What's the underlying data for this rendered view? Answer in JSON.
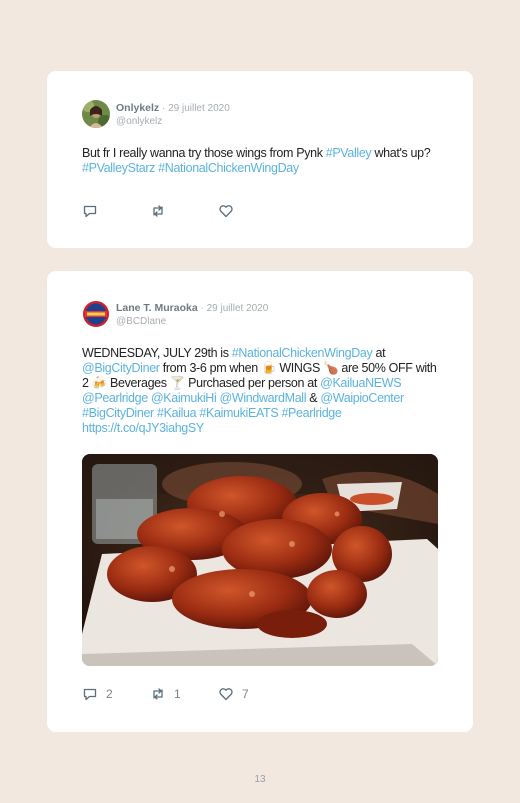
{
  "tweets": [
    {
      "name": "Onlykelz",
      "sep": " · ",
      "date": "29 juillet 2020",
      "handle": "@onlykelz",
      "text": [
        {
          "t": "But fr I really wanna try those wings from Pynk "
        },
        {
          "t": "#PValley",
          "tag": true
        },
        {
          "t": " what's up? "
        },
        {
          "t": "#PValleyStarz",
          "tag": true
        },
        {
          "t": " "
        },
        {
          "t": "#NationalChickenWingDay",
          "tag": true
        }
      ],
      "replies": "",
      "retweets": "",
      "likes": ""
    },
    {
      "name": "Lane T. Muraoka",
      "sep": " · ",
      "date": "29 juillet 2020",
      "handle": "@BCDlane",
      "text": [
        {
          "t": "WEDNESDAY, JULY 29th is "
        },
        {
          "t": "#NationalChickenWingDay",
          "tag": true
        },
        {
          "t": " at "
        },
        {
          "t": "@BigCityDiner",
          "tag": true
        },
        {
          "t": " from 3-6 pm when 🍺 WINGS 🍗 are 50% OFF with 2 🍻 Beverages 🍸 Purchased per person at "
        },
        {
          "t": "@KailuaNEWS",
          "tag": true
        },
        {
          "t": " "
        },
        {
          "t": "@Pearlridge",
          "tag": true
        },
        {
          "t": " "
        },
        {
          "t": "@KaimukiHi",
          "tag": true
        },
        {
          "t": " "
        },
        {
          "t": "@WindwardMall",
          "tag": true
        },
        {
          "t": " & "
        },
        {
          "t": "@WaipioCenter",
          "tag": true
        },
        {
          "t": " "
        },
        {
          "t": "#BigCityDiner",
          "tag": true
        },
        {
          "t": " "
        },
        {
          "t": "#Kailua",
          "tag": true
        },
        {
          "t": " "
        },
        {
          "t": "#KaimukiEATS",
          "tag": true
        },
        {
          "t": " "
        },
        {
          "t": "#Pearlridge",
          "tag": true
        },
        {
          "t": " "
        },
        {
          "t": "https://t.co/qJY3iahgSY",
          "tag": true
        }
      ],
      "replies": "2",
      "retweets": "1",
      "likes": "7"
    }
  ],
  "page_number": "13",
  "colors": {
    "tag": "#5ab3df",
    "background": "#f3e8df",
    "card": "#ffffff"
  },
  "icons": [
    "reply-icon",
    "retweet-icon",
    "heart-icon"
  ]
}
